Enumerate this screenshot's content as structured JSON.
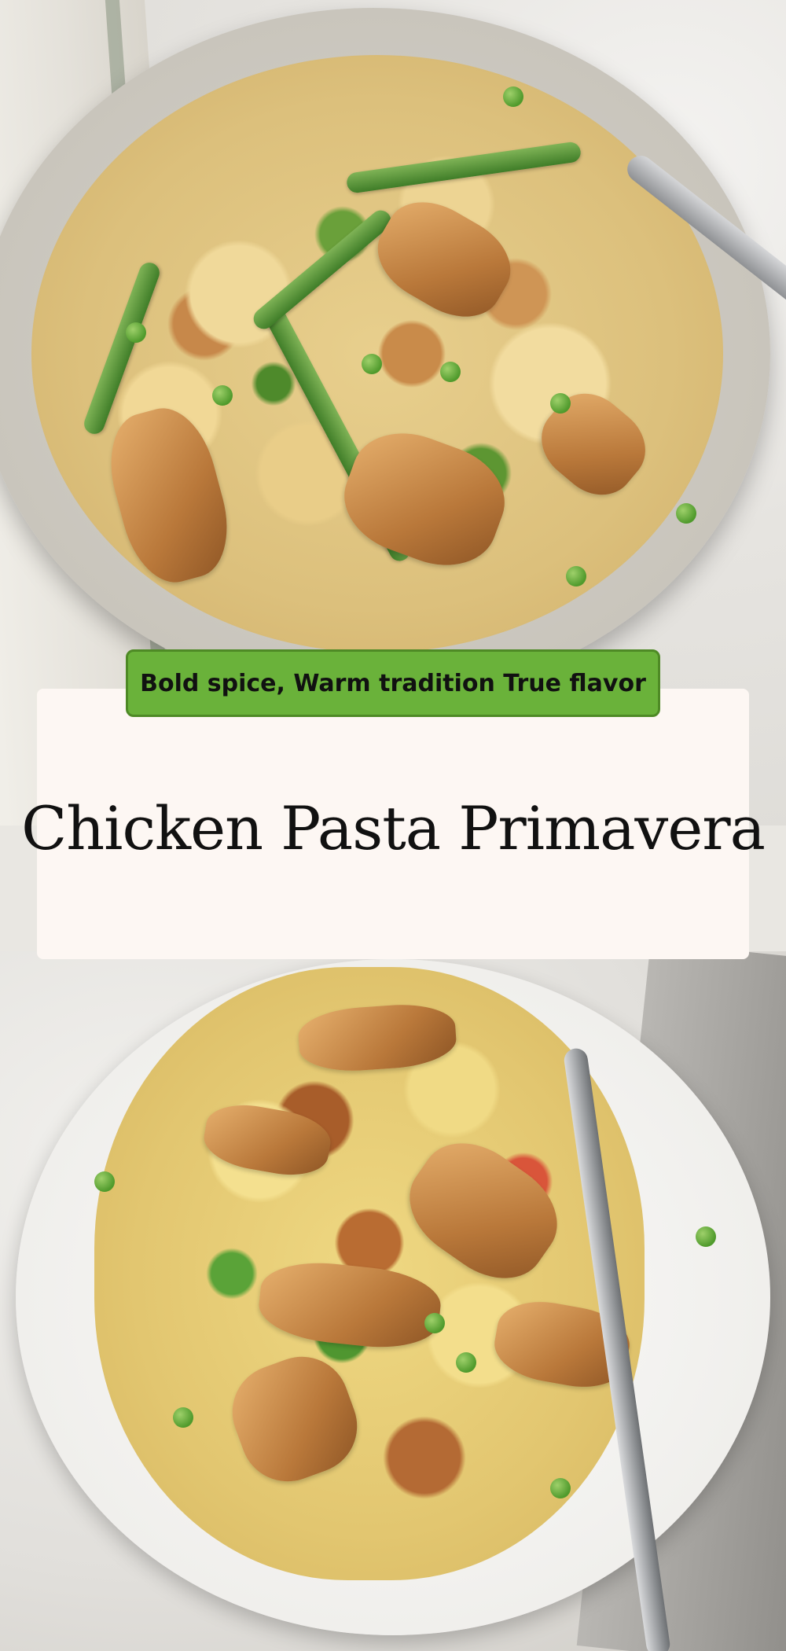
{
  "banner": {
    "tagline": "Bold spice, Warm tradition True flavor",
    "title": "Chicken Pasta Primavera"
  },
  "colors": {
    "tagline_background": "#6ab23a",
    "title_card_background": "#fdf7f3",
    "text": "#111111"
  },
  "images": {
    "top": "bow-tie-pasta-with-chicken-asparagus-peas",
    "bottom": "rotini-pasta-with-grilled-chicken-peas-tomatoes"
  }
}
